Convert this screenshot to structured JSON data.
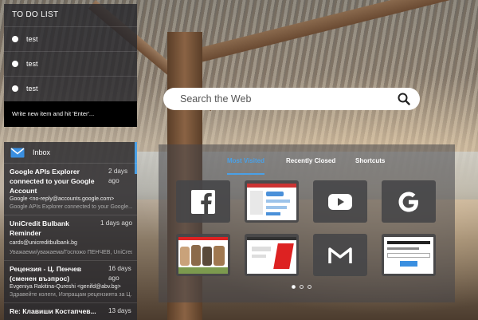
{
  "todo": {
    "title": "TO DO LIST",
    "items": [
      {
        "label": "test"
      },
      {
        "label": "test"
      },
      {
        "label": "test"
      }
    ],
    "new_item_placeholder": "Write new item and hit 'Enter'..."
  },
  "inbox": {
    "title": "Inbox",
    "emails": [
      {
        "subject": "Google APIs Explorer connected to your Google Account",
        "time": "2 days ago",
        "from": "Google <no-reply@accounts.google.com>",
        "snippet": "Google APIs Explorer connected to your Google..."
      },
      {
        "subject": "UniCredit Bulbank Reminder",
        "time": "1 days ago",
        "from": "cards@unicreditbulbank.bg",
        "snippet": "Уважаеми/уважаема/Госпожо ПЕНЧЕВ, UniCred..."
      },
      {
        "subject": "Рецензия - Ц. Пенчев (сменен възпрос)",
        "time": "16 days ago",
        "from": "Evgeniya Rakitina-Qureshi <genifd@abv.bg>",
        "snippet": "Здравейте колеги, Изпращам рецензията за Ц..."
      },
      {
        "subject": "Re: Клавиши Костапчев...",
        "time": "13 days",
        "from": "",
        "snippet": ""
      }
    ]
  },
  "search": {
    "placeholder": "Search the Web",
    "icon": "search-icon"
  },
  "speed_dial": {
    "tabs": [
      {
        "label": "Most Visited",
        "active": true
      },
      {
        "label": "Recently Closed",
        "active": false
      },
      {
        "label": "Shortcuts",
        "active": false
      }
    ],
    "tiles": [
      {
        "icon": "facebook-icon"
      },
      {
        "icon": "page-thumbnail"
      },
      {
        "icon": "youtube-icon"
      },
      {
        "icon": "google-icon"
      },
      {
        "icon": "dogs-thumbnail"
      },
      {
        "icon": "fashion-thumbnail"
      },
      {
        "icon": "gmail-icon"
      },
      {
        "icon": "chrome-extension-downloader-thumbnail"
      }
    ],
    "pages": 3,
    "current_page": 1
  },
  "colors": {
    "accent": "#4aa0e6",
    "panel": "#28282d"
  }
}
